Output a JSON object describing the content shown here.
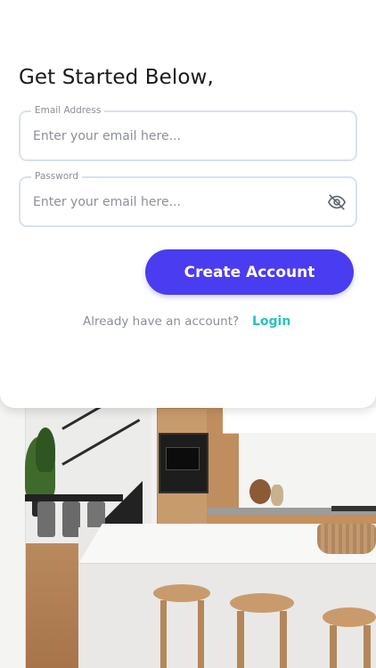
{
  "form": {
    "title": "Get Started Below,",
    "email": {
      "label": "Email Address",
      "placeholder": "Enter your email here...",
      "value": ""
    },
    "password": {
      "label": "Password",
      "placeholder": "Enter your email here...",
      "value": "",
      "toggle_icon": "eye-off-icon"
    },
    "submit_label": "Create Account",
    "login_prompt": "Already have an account?",
    "login_link": "Login"
  },
  "colors": {
    "primary_button": "#4a3cf0",
    "link": "#27c2c4",
    "field_border": "#d9e1ec",
    "title_text": "#1b1b1b",
    "muted_text": "#8a8f97"
  },
  "background": {
    "image": "kitchen-interior-photo"
  }
}
